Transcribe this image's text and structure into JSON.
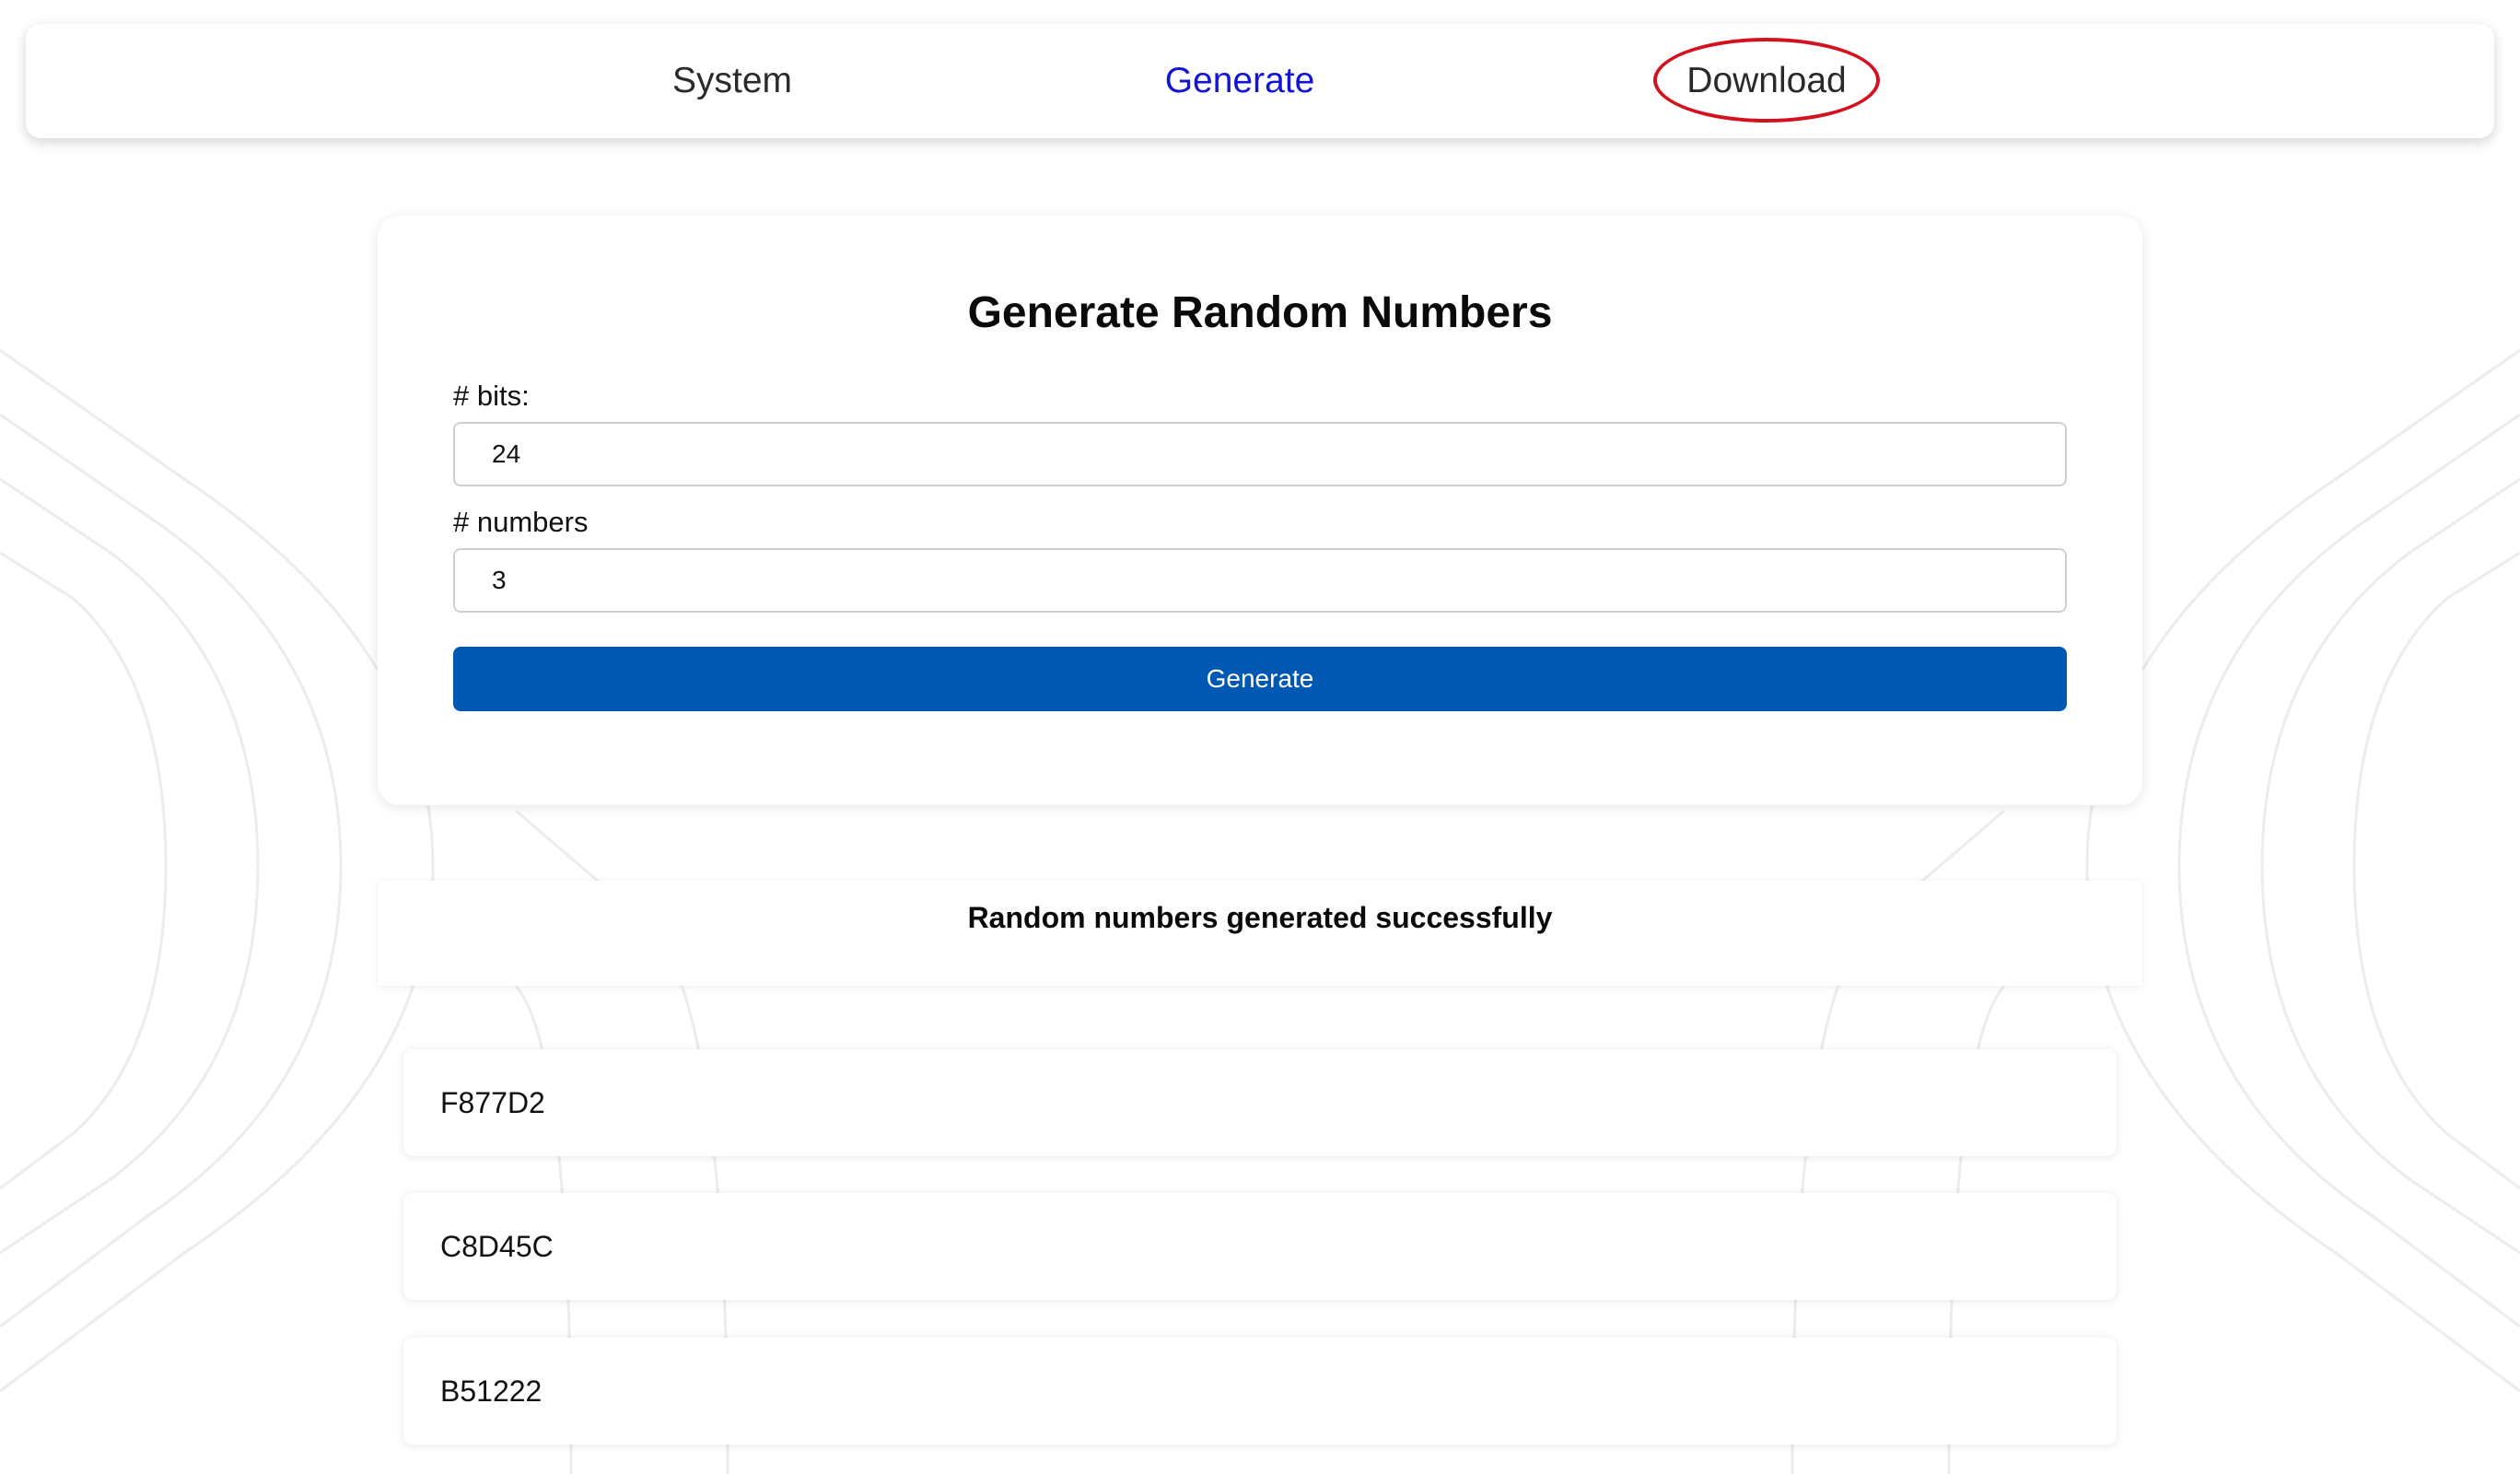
{
  "nav": {
    "items": [
      {
        "label": "System"
      },
      {
        "label": "Generate",
        "active": true
      },
      {
        "label": "Download",
        "highlighted": true
      }
    ]
  },
  "form": {
    "title": "Generate Random Numbers",
    "bits_label": "# bits:",
    "bits_value": "24",
    "numbers_label": "# numbers",
    "numbers_value": "3",
    "button_label": "Generate"
  },
  "status": {
    "message": "Random numbers generated successfully"
  },
  "results": [
    "F877D2",
    "C8D45C",
    "B51222"
  ],
  "colors": {
    "active_nav": "#1414d4",
    "button_bg": "#0158b2",
    "highlight_ring": "#d4111e"
  }
}
